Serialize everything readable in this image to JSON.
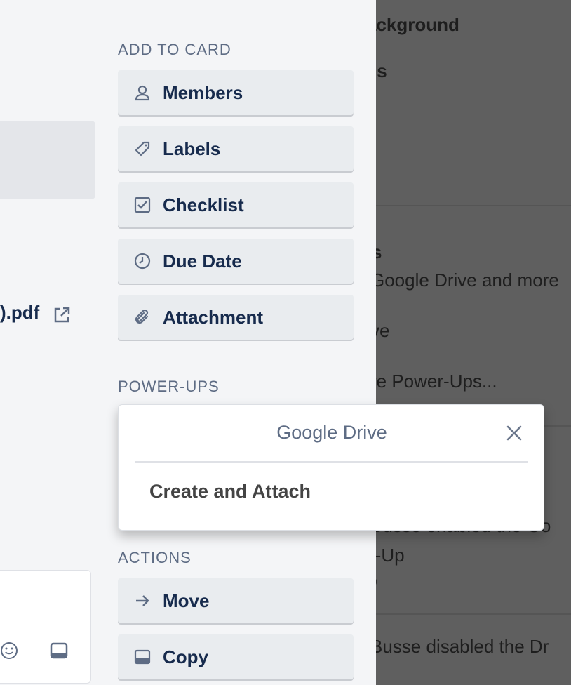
{
  "board": {
    "lines": [
      {
        "text": "ackground",
        "bold": true
      },
      {
        "text": "ls",
        "bold": true
      },
      {
        "text": "s",
        "bold": true
      },
      {
        "text": "Google Drive and more",
        "bold": false
      },
      {
        "text": "ve",
        "bold": false
      },
      {
        "text": "re Power-Ups...",
        "bold": false
      },
      {
        "text": "Busse enabled the Go",
        "bold": false
      },
      {
        "text": "r-Up",
        "bold": false
      },
      {
        "text": "o",
        "bold": false
      },
      {
        "text": "Busse disabled the Dr",
        "bold": false
      }
    ]
  },
  "card": {
    "attachment_name": ").pdf"
  },
  "sidebar": {
    "add_to_card_heading": "ADD TO CARD",
    "add_to_card": [
      {
        "label": "Members",
        "icon": "person-icon"
      },
      {
        "label": "Labels",
        "icon": "tag-icon"
      },
      {
        "label": "Checklist",
        "icon": "checkbox-icon"
      },
      {
        "label": "Due Date",
        "icon": "clock-icon"
      },
      {
        "label": "Attachment",
        "icon": "paperclip-icon"
      }
    ],
    "powerups_heading": "POWER-UPS",
    "actions_heading": "ACTIONS",
    "actions": [
      {
        "label": "Move",
        "icon": "arrow-right-icon"
      },
      {
        "label": "Copy",
        "icon": "card-icon"
      }
    ]
  },
  "popover": {
    "title": "Google Drive",
    "item": "Create and Attach"
  },
  "colors": {
    "accent_text": "#172b4d",
    "muted_text": "#5e6c84",
    "button_bg": "#e9ecef",
    "panel_bg": "#f4f5f7"
  }
}
